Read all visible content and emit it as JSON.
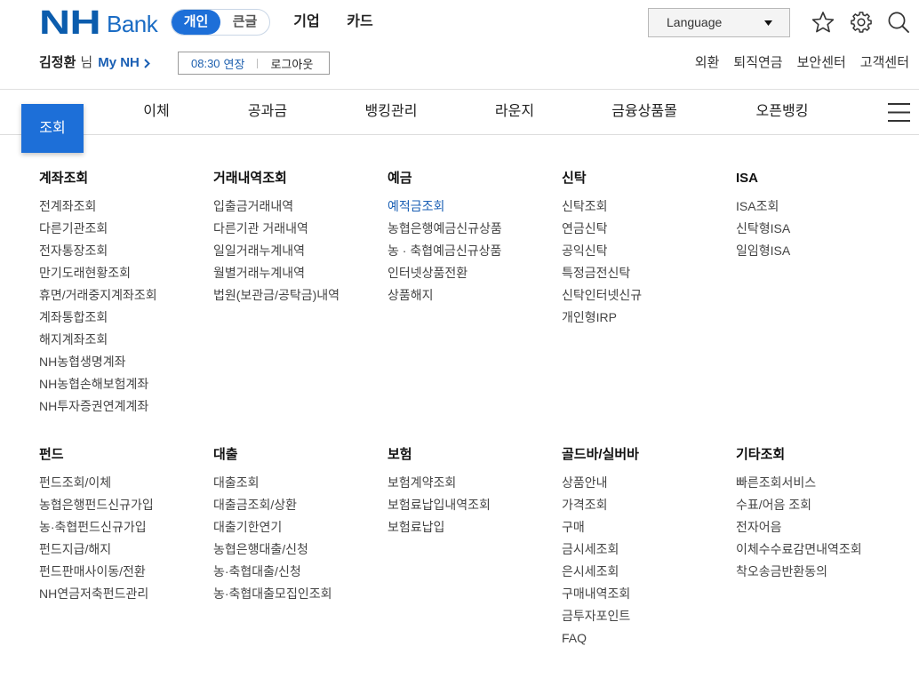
{
  "header": {
    "logo": {
      "mark": "NH",
      "word": "Bank"
    },
    "mode_toggle": {
      "options": [
        "개인",
        "큰글"
      ],
      "selected": "개인"
    },
    "top_links": [
      "기업",
      "카드"
    ],
    "language": {
      "label": "Language",
      "icon": "caret-down-icon"
    },
    "icons": [
      "star-icon",
      "gear-icon",
      "search-icon"
    ]
  },
  "user_bar": {
    "name": "김정환",
    "honorific": "님",
    "mynh": "My NH",
    "session": {
      "time": "08:30",
      "extend": "연장",
      "logout": "로그아웃"
    },
    "links": [
      "외환",
      "퇴직연금",
      "보안센터",
      "고객센터"
    ]
  },
  "gnb": {
    "active": "조회",
    "items": [
      "이체",
      "공과금",
      "뱅킹관리",
      "라운지",
      "금융상품몰",
      "오픈뱅킹"
    ],
    "menu_icon": "hamburger-menu-icon"
  },
  "mega_menu": {
    "active_item": "예적금조회",
    "groups": [
      {
        "title": "계좌조회",
        "items": [
          "전계좌조회",
          "다른기관조회",
          "전자통장조회",
          "만기도래현황조회",
          "휴면/거래중지계좌조회",
          "계좌통합조회",
          "해지계좌조회",
          "NH농협생명계좌",
          "NH농협손해보험계좌",
          "NH투자증권연계계좌"
        ]
      },
      {
        "title": "거래내역조회",
        "items": [
          "입출금거래내역",
          "다른기관 거래내역",
          "일일거래누계내역",
          "월별거래누계내역",
          "법원(보관금/공탁금)내역"
        ]
      },
      {
        "title": "예금",
        "items": [
          "예적금조회",
          "농협은행예금신규상품",
          "농 · 축협예금신규상품",
          "인터넷상품전환",
          "상품해지"
        ]
      },
      {
        "title": "신탁",
        "items": [
          "신탁조회",
          "연금신탁",
          "공익신탁",
          "특정금전신탁",
          "신탁인터넷신규",
          "개인형IRP"
        ]
      },
      {
        "title": "ISA",
        "items": [
          "ISA조회",
          "신탁형ISA",
          "일임형ISA"
        ]
      },
      {
        "title": "펀드",
        "items": [
          "펀드조회/이체",
          "농협은행펀드신규가입",
          "농·축협펀드신규가입",
          "펀드지급/해지",
          "펀드판매사이동/전환",
          "NH연금저축펀드관리"
        ]
      },
      {
        "title": "대출",
        "items": [
          "대출조회",
          "대출금조회/상환",
          "대출기한연기",
          "농협은행대출/신청",
          "농·축협대출/신청",
          "농·축협대출모집인조회"
        ]
      },
      {
        "title": "보험",
        "items": [
          "보험계약조회",
          "보험료납입내역조회",
          "보험료납입"
        ]
      },
      {
        "title": "골드바/실버바",
        "items": [
          "상품안내",
          "가격조회",
          "구매",
          "금시세조회",
          "은시세조회",
          "구매내역조회",
          "금투자포인트",
          "FAQ"
        ]
      },
      {
        "title": "기타조회",
        "items": [
          "빠른조회서비스",
          "수표/어음 조회",
          "전자어음",
          "이체수수료감면내역조회",
          "착오송금반환동의"
        ]
      }
    ]
  },
  "colors": {
    "primary": "#1d6fd8",
    "brand": "#0b5cad",
    "active_link": "#1a5fb4"
  }
}
